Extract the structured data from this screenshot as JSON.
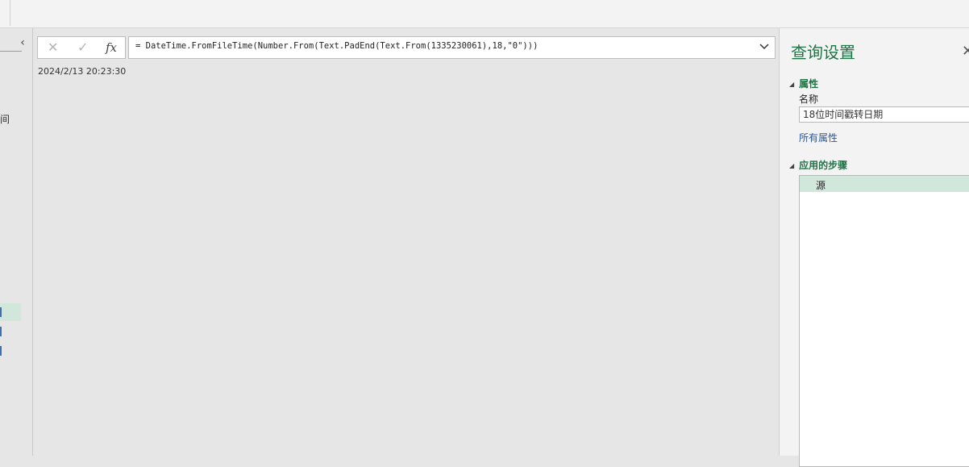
{
  "left_pane": {
    "collapse_icon": "chevron-left-icon",
    "truncated_label": "间"
  },
  "formula_bar": {
    "cancel_icon": "x-icon",
    "commit_icon": "check-icon",
    "fx_label": "fx",
    "formula": "= DateTime.FromFileTime(Number.From(Text.PadEnd(Text.From(1335230061),18,\"0\")))",
    "expand_icon": "chevron-down-icon"
  },
  "result": {
    "value": "2024/2/13 20:23:30"
  },
  "query_settings": {
    "title": "查询设置",
    "close_icon": "close-icon",
    "properties_section": "属性",
    "name_label": "名称",
    "name_value": "18位时间戳转日期",
    "all_properties_link": "所有属性",
    "applied_steps_section": "应用的步骤",
    "steps": [
      {
        "label": "源"
      }
    ]
  },
  "colors": {
    "accent": "#217346",
    "link": "#2b5797",
    "selection": "#d2e7dc"
  }
}
